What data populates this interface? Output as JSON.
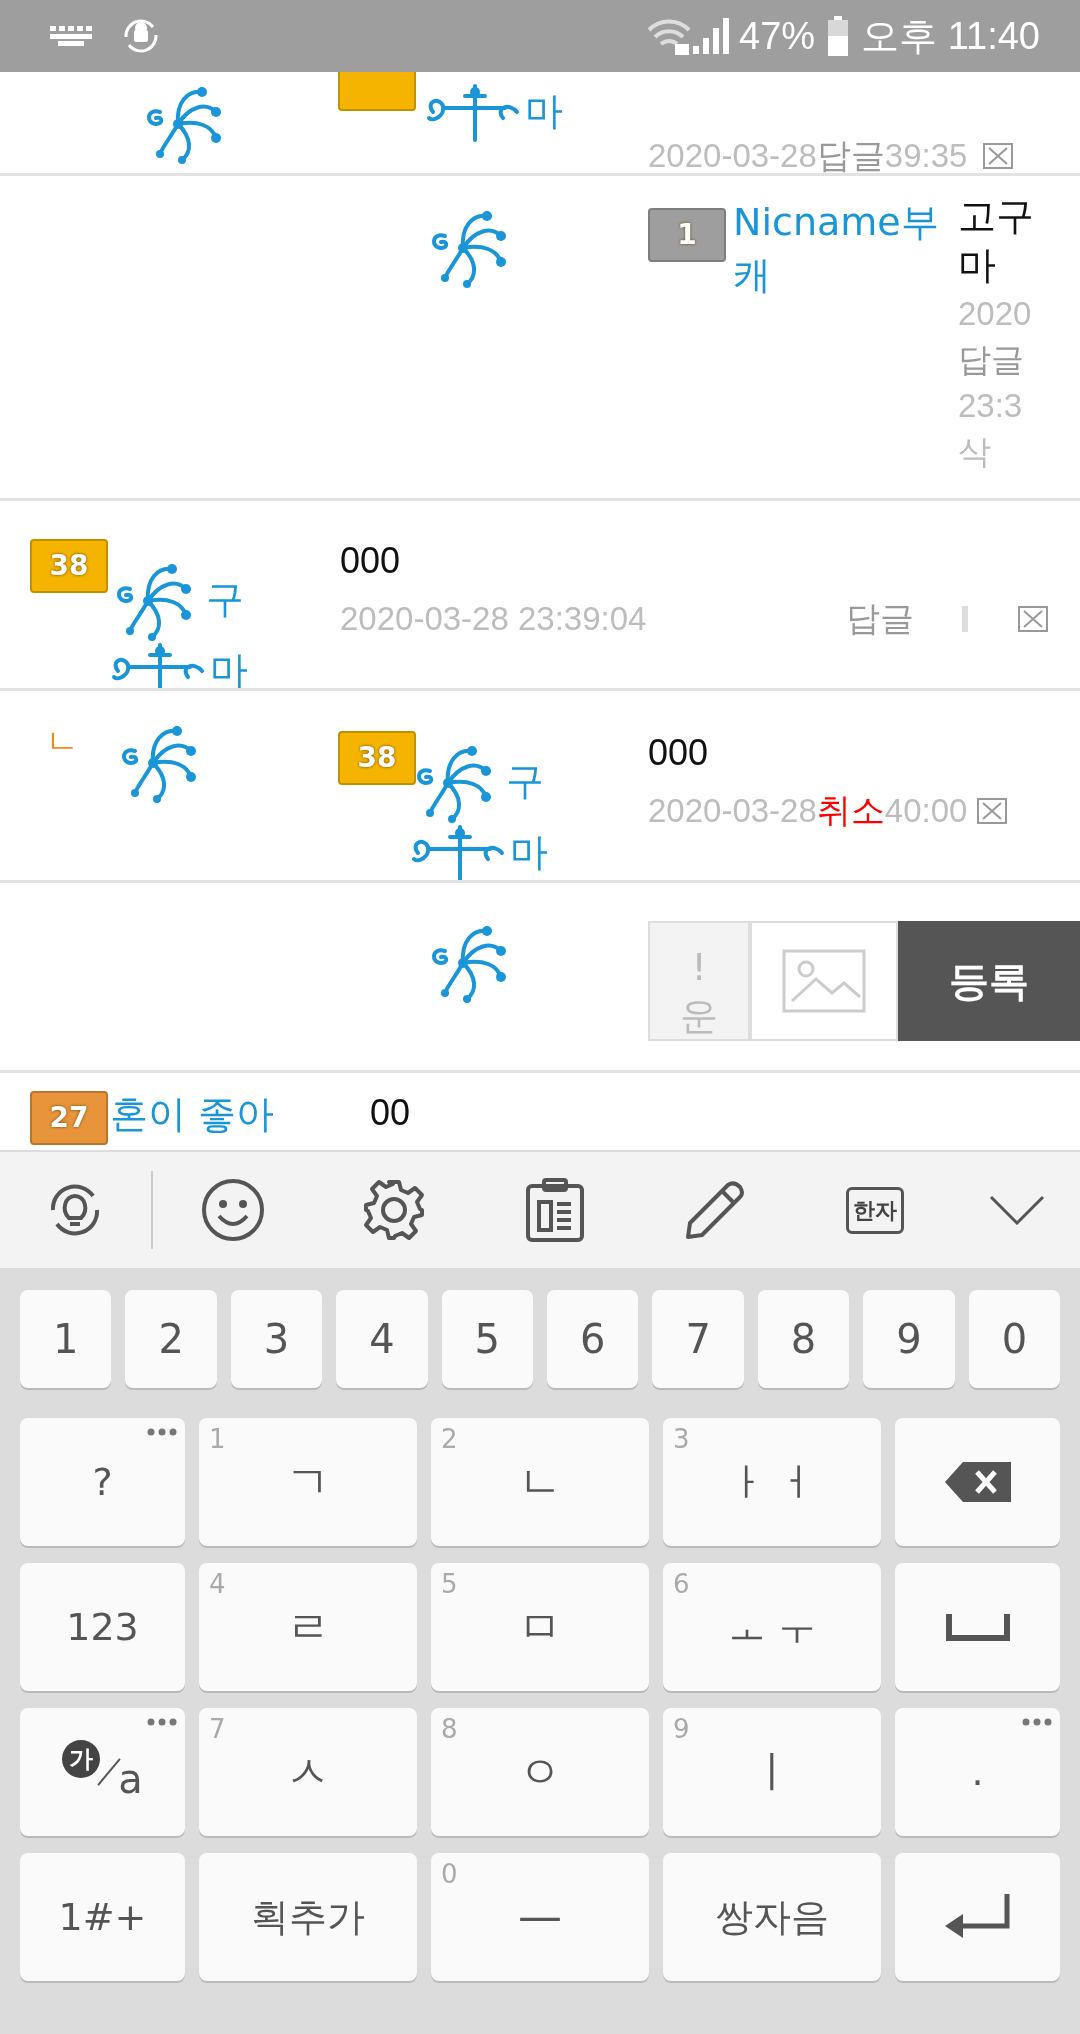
{
  "status_bar": {
    "battery": "47%",
    "time": "오후 11:40"
  },
  "comments": [
    {
      "kind": "cut_top",
      "badge": {
        "color": "#f5b400"
      },
      "nickname": [
        "마"
      ],
      "date": "2020-03-28",
      "action": {
        "text": "답글",
        "kind": "reply"
      },
      "time": "39:35"
    },
    {
      "kind": "narrow",
      "badge": {
        "text": "1",
        "color": "#9e9e9e"
      },
      "nickname": [
        "Nicname부캐"
      ],
      "content": "고구마",
      "meta": [
        "2020",
        "답글",
        "23:3",
        "삭"
      ]
    },
    {
      "kind": "comment",
      "badge": {
        "text": "38",
        "color": "#f5b400"
      },
      "nickname": [
        "구",
        "마"
      ],
      "content": "000",
      "date": "2020-03-28 23:39:04",
      "action": {
        "text": "답글",
        "kind": "reply"
      }
    },
    {
      "kind": "reply",
      "marker": "ㄴ",
      "badge": {
        "text": "38",
        "color": "#f5b400"
      },
      "nickname": [
        "구",
        "마"
      ],
      "content": "000",
      "date": "2020-03-28",
      "action": {
        "text": "취소",
        "kind": "cancel"
      },
      "time": "40:00"
    },
    {
      "kind": "compose",
      "input_lines": [
        "!",
        "운"
      ],
      "submit": "등록"
    },
    {
      "kind": "cut_bottom",
      "badge": {
        "text": "27",
        "color": "#e8943a"
      },
      "nickname": [
        "혼이 좋아"
      ],
      "content": "00"
    }
  ],
  "keyboard": {
    "toolbar": {
      "hanja": "한자"
    },
    "number_row": [
      "1",
      "2",
      "3",
      "4",
      "5",
      "6",
      "7",
      "8",
      "9",
      "0"
    ],
    "rows": [
      [
        {
          "kind": "text",
          "label": "?",
          "more": true
        },
        {
          "kind": "text",
          "label": "ㄱ",
          "hint": "1"
        },
        {
          "kind": "text",
          "label": "ㄴ",
          "hint": "2"
        },
        {
          "kind": "text",
          "label": "ㅏ ㅓ",
          "hint": "3"
        },
        {
          "kind": "backspace"
        }
      ],
      [
        {
          "kind": "text",
          "label": "123"
        },
        {
          "kind": "text",
          "label": "ㄹ",
          "hint": "4"
        },
        {
          "kind": "text",
          "label": "ㅁ",
          "hint": "5"
        },
        {
          "kind": "text",
          "label": "ㅗ ㅜ",
          "hint": "6"
        },
        {
          "kind": "space"
        }
      ],
      [
        {
          "kind": "lang",
          "label": "가",
          "alt": "a",
          "more": true
        },
        {
          "kind": "text",
          "label": "ㅅ",
          "hint": "7"
        },
        {
          "kind": "text",
          "label": "ㅇ",
          "hint": "8"
        },
        {
          "kind": "text",
          "label": "ㅣ",
          "hint": "9"
        },
        {
          "kind": "text",
          "label": ".",
          "more": true
        }
      ],
      [
        {
          "kind": "text",
          "label": "1#+"
        },
        {
          "kind": "text",
          "label": "획추가"
        },
        {
          "kind": "text",
          "label": "—",
          "hint": "0"
        },
        {
          "kind": "text",
          "label": "쌍자음"
        },
        {
          "kind": "enter"
        }
      ]
    ]
  }
}
